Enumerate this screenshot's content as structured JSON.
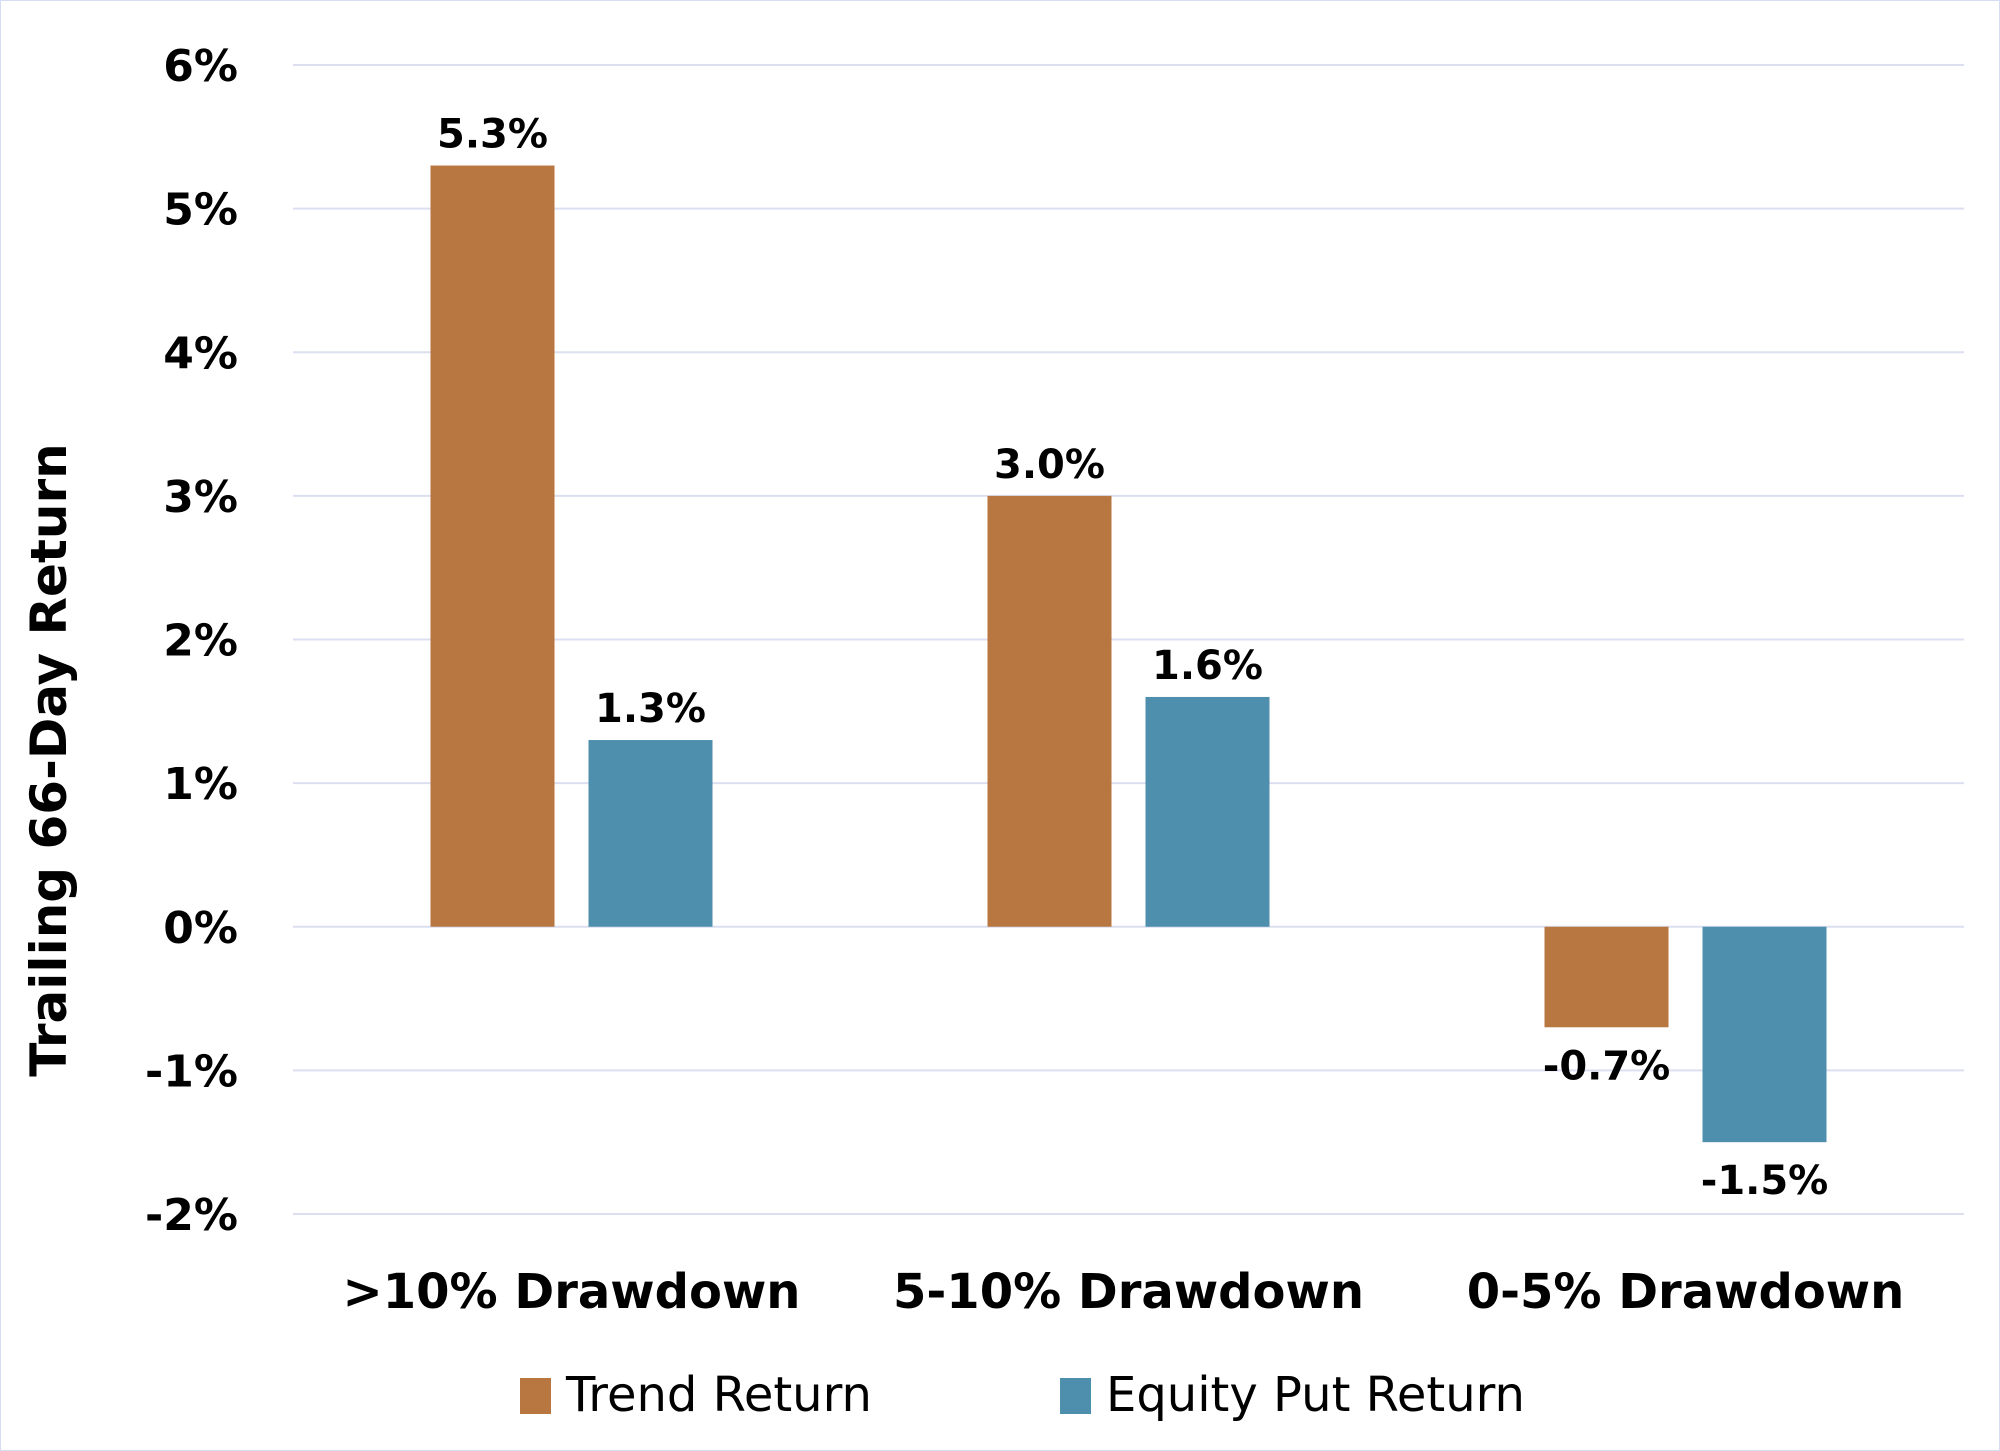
{
  "chart_data": {
    "type": "bar",
    "title": "",
    "xlabel": "",
    "ylabel": "Trailing 66-Day Return",
    "categories": [
      ">10% Drawdown",
      "5-10% Drawdown",
      "0-5% Drawdown"
    ],
    "series": [
      {
        "name": "Trend Return",
        "color": "#b87640",
        "values": [
          5.3,
          3.0,
          -0.7
        ],
        "labels": [
          "5.3%",
          "3.0%",
          "-0.7%"
        ]
      },
      {
        "name": "Equity Put Return",
        "color": "#4f8fae",
        "values": [
          1.3,
          1.6,
          -1.5
        ],
        "labels": [
          "1.3%",
          "1.6%",
          "-1.5%"
        ]
      }
    ],
    "ylim": [
      -2,
      6
    ],
    "yticks": [
      6,
      5,
      4,
      3,
      2,
      1,
      0,
      -1,
      -2
    ],
    "ytick_labels": [
      "6%",
      "5%",
      "4%",
      "3%",
      "2%",
      "1%",
      "0%",
      "-1%",
      "-2%"
    ],
    "grid": true,
    "legend_position": "bottom"
  }
}
